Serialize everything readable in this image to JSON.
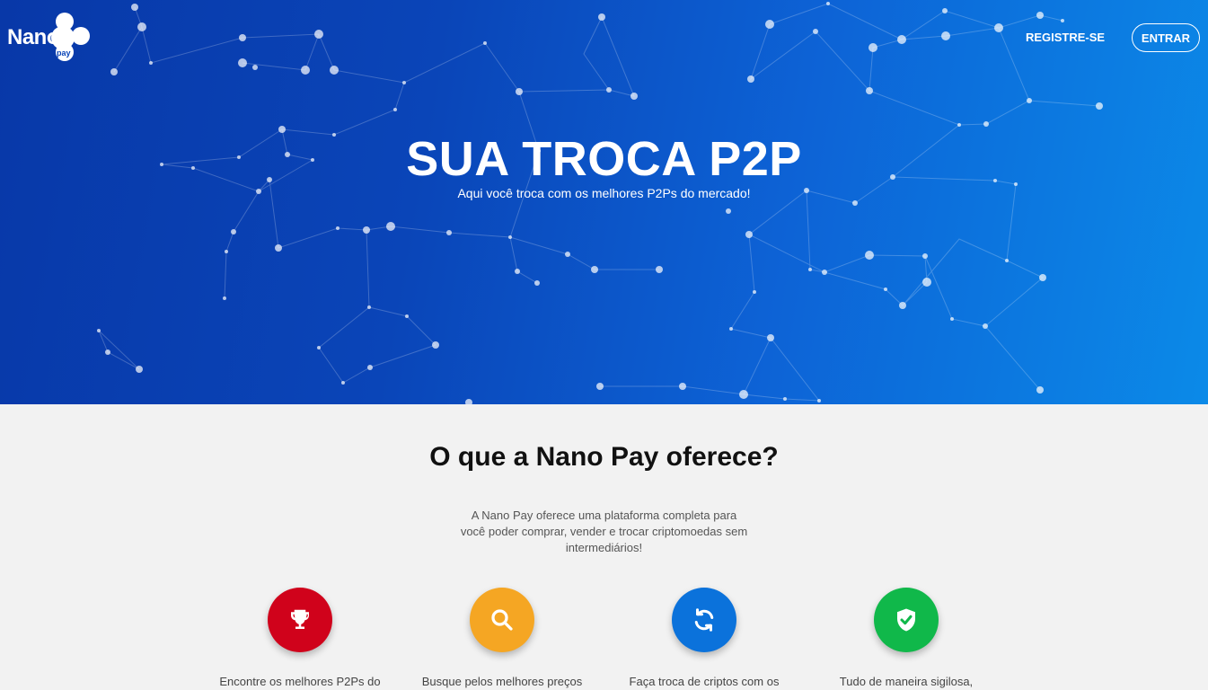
{
  "brand": {
    "name": "Nano",
    "sub": "pay"
  },
  "nav": {
    "register_label": "REGISTRE-SE",
    "login_label": "ENTRAR"
  },
  "hero": {
    "title": "SUA TROCA P2P",
    "subtitle": "Aqui você troca com os melhores P2Ps do mercado!"
  },
  "offer": {
    "title": "O que a Nano Pay oferece?",
    "description": "A Nano Pay oferece uma plataforma completa para você poder comprar, vender e trocar criptomoedas sem intermediários!"
  },
  "features": [
    {
      "icon": "trophy-icon",
      "color": "#d0021b",
      "text": "Encontre os melhores P2Ps do"
    },
    {
      "icon": "search-icon",
      "color": "#f5a623",
      "text": "Busque pelos melhores preços"
    },
    {
      "icon": "exchange-icon",
      "color": "#0b72db",
      "text": "Faça troca de criptos com os"
    },
    {
      "icon": "shield-check-icon",
      "color": "#10b84a",
      "text": "Tudo de maneira sigilosa,"
    }
  ],
  "colors": {
    "hero_start": "#0838a8",
    "hero_end": "#0b8ae8",
    "background": "#f2f2f2"
  }
}
